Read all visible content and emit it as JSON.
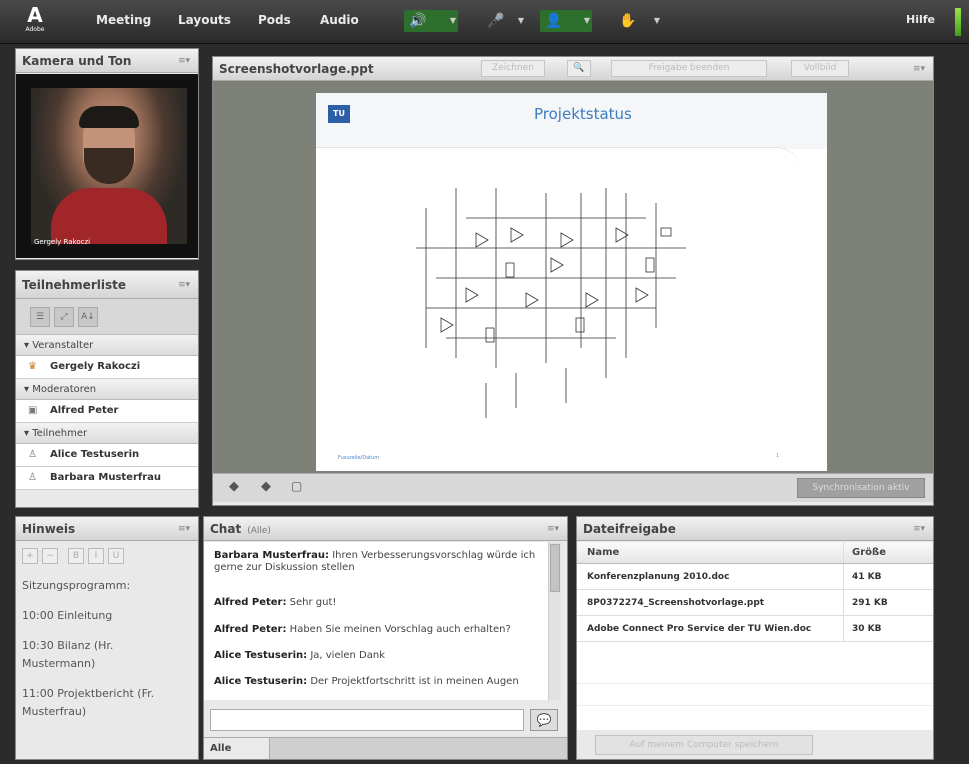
{
  "topbar": {
    "menus": [
      "Meeting",
      "Layouts",
      "Pods",
      "Audio"
    ],
    "help": "Hilfe",
    "adobe": "Adobe",
    "accent": "#2d6f2d"
  },
  "camera_pod": {
    "title": "Kamera und Ton",
    "person_name": "Gergely Rakoczi"
  },
  "participants_pod": {
    "title": "Teilnehmerliste",
    "groups": [
      {
        "label": "Veranstalter",
        "users": [
          "Gergely Rakoczi"
        ]
      },
      {
        "label": "Moderatoren",
        "users": [
          "Alfred Peter"
        ]
      },
      {
        "label": "Teilnehmer",
        "users": [
          "Alice Testuserin",
          "Barbara Musterfrau"
        ]
      }
    ]
  },
  "note_pod": {
    "title": "Hinweis",
    "lines": [
      "Sitzungsprogramm:",
      "10:00 Einleitung",
      "10:30 Bilanz (Hr.",
      "Mustermann)",
      "11:00 Projektbericht (Fr.",
      "Musterfrau)"
    ]
  },
  "share_pod": {
    "title": "Screenshotvorlage.ppt",
    "buttons": [
      "Zeichnen",
      "Freigabe beenden",
      "Vollbild"
    ],
    "slide_title": "Projektstatus",
    "slide_logo": "TU",
    "slide_footer": "Fusszeile/Datum",
    "sync_label": "Synchronisation aktiv"
  },
  "chat_pod": {
    "title": "Chat",
    "subtitle": "(Alle)",
    "messages": [
      {
        "author": "Barbara Musterfrau:",
        "text": "Ihren Verbesserungsvorschlag würde ich gerne zur Diskussion stellen"
      },
      {
        "author": "Alfred Peter:",
        "text": "Sehr gut!"
      },
      {
        "author": "Alfred Peter:",
        "text": "Haben Sie meinen Vorschlag auch erhalten?"
      },
      {
        "author": "Alice Testuserin:",
        "text": "Ja, vielen Dank"
      },
      {
        "author": "Alice Testuserin:",
        "text": "Der Projektfortschritt ist in meinen Augen"
      }
    ],
    "input_placeholder": "",
    "tab_label": "Alle"
  },
  "files_pod": {
    "title": "Dateifreigabe",
    "columns": [
      "Name",
      "Größe"
    ],
    "rows": [
      {
        "name": "Konferenzplanung 2010.doc",
        "size": "41 KB"
      },
      {
        "name": "8P0372274_Screenshotvorlage.ppt",
        "size": "291 KB"
      },
      {
        "name": "Adobe Connect Pro Service der TU Wien.doc",
        "size": "30 KB"
      }
    ],
    "download_label": "Auf meinem Computer speichern"
  }
}
